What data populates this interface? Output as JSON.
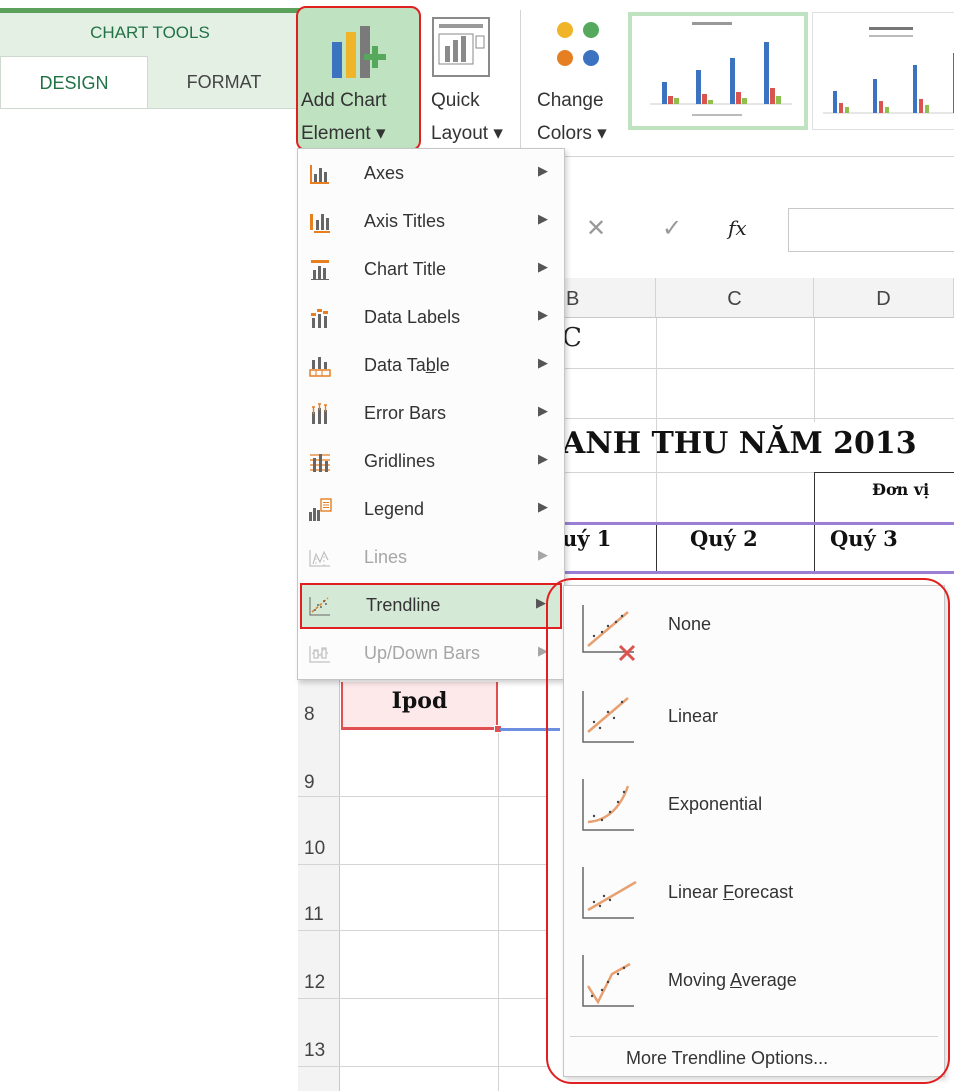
{
  "ribbon": {
    "context_label": "CHART TOOLS",
    "tabs": [
      {
        "label": "DESIGN",
        "active": true
      },
      {
        "label": "FORMAT",
        "active": false
      }
    ],
    "buttons": {
      "add_chart_element": {
        "line1": "Add Chart",
        "line2": "Element ▾",
        "icon": "add-chart-element-icon"
      },
      "quick_layout": {
        "line1": "Quick",
        "line2": "Layout ▾",
        "icon": "quick-layout-icon"
      },
      "change_colors": {
        "line1": "Change",
        "line2": "Colors ▾",
        "icon": "change-colors-icon"
      }
    },
    "chart_styles": [
      {
        "name": "Chart Style 1",
        "selected": true
      },
      {
        "name": "Chart Style 2",
        "selected": false
      }
    ],
    "colors": {
      "accent_green": "#217346",
      "highlight_green": "#bfe2c1",
      "callout_red": "#e02020"
    }
  },
  "formula_bar": {
    "cancel_glyph": "✕",
    "enter_glyph": "✓",
    "fx_label": "fx",
    "value": ""
  },
  "sheet": {
    "column_headers": [
      "B",
      "C",
      "D"
    ],
    "cell_c_fragment": "C",
    "title": "ANH THU NĂM 2013",
    "unit_label": "Đơn vị",
    "quarter_headers": [
      "uý 1",
      "Quý 2",
      "Quý 3"
    ],
    "row_numbers": [
      "8",
      "9",
      "10",
      "11",
      "12",
      "13"
    ],
    "selected_cell_value": "Ipod"
  },
  "chart_element_menu": {
    "items": [
      {
        "label": "Axes",
        "icon": "axes-icon",
        "enabled": true,
        "highlighted": false,
        "has_submenu": true
      },
      {
        "label": "Axis Titles",
        "icon": "axis-titles-icon",
        "enabled": true,
        "highlighted": false,
        "has_submenu": true
      },
      {
        "label": "Chart Title",
        "icon": "chart-title-icon",
        "enabled": true,
        "highlighted": false,
        "has_submenu": true
      },
      {
        "label": "Data Labels",
        "icon": "data-labels-icon",
        "enabled": true,
        "highlighted": false,
        "has_submenu": true
      },
      {
        "label": "Data Table",
        "icon": "data-table-icon",
        "enabled": true,
        "highlighted": false,
        "has_submenu": true
      },
      {
        "label": "Error Bars",
        "icon": "error-bars-icon",
        "enabled": true,
        "highlighted": false,
        "has_submenu": true
      },
      {
        "label": "Gridlines",
        "icon": "gridlines-icon",
        "enabled": true,
        "highlighted": false,
        "has_submenu": true
      },
      {
        "label": "Legend",
        "icon": "legend-icon",
        "enabled": true,
        "highlighted": false,
        "has_submenu": true
      },
      {
        "label": "Lines",
        "icon": "lines-icon",
        "enabled": false,
        "highlighted": false,
        "has_submenu": true
      },
      {
        "label": "Trendline",
        "icon": "trendline-icon",
        "enabled": true,
        "highlighted": true,
        "has_submenu": true
      },
      {
        "label": "Up/Down Bars",
        "icon": "up-down-bars-icon",
        "enabled": false,
        "highlighted": false,
        "has_submenu": true
      }
    ],
    "submenu_arrow": "▶"
  },
  "trendline_submenu": {
    "items": [
      {
        "label": "None",
        "icon": "trendline-none-icon"
      },
      {
        "label": "Linear",
        "icon": "trendline-linear-icon"
      },
      {
        "label": "Exponential",
        "icon": "trendline-exponential-icon"
      },
      {
        "label": "Linear Forecast",
        "icon": "trendline-linear-forecast-icon"
      },
      {
        "label": "Moving Average",
        "icon": "trendline-moving-average-icon"
      }
    ],
    "more_options": "More Trendline Options..."
  }
}
